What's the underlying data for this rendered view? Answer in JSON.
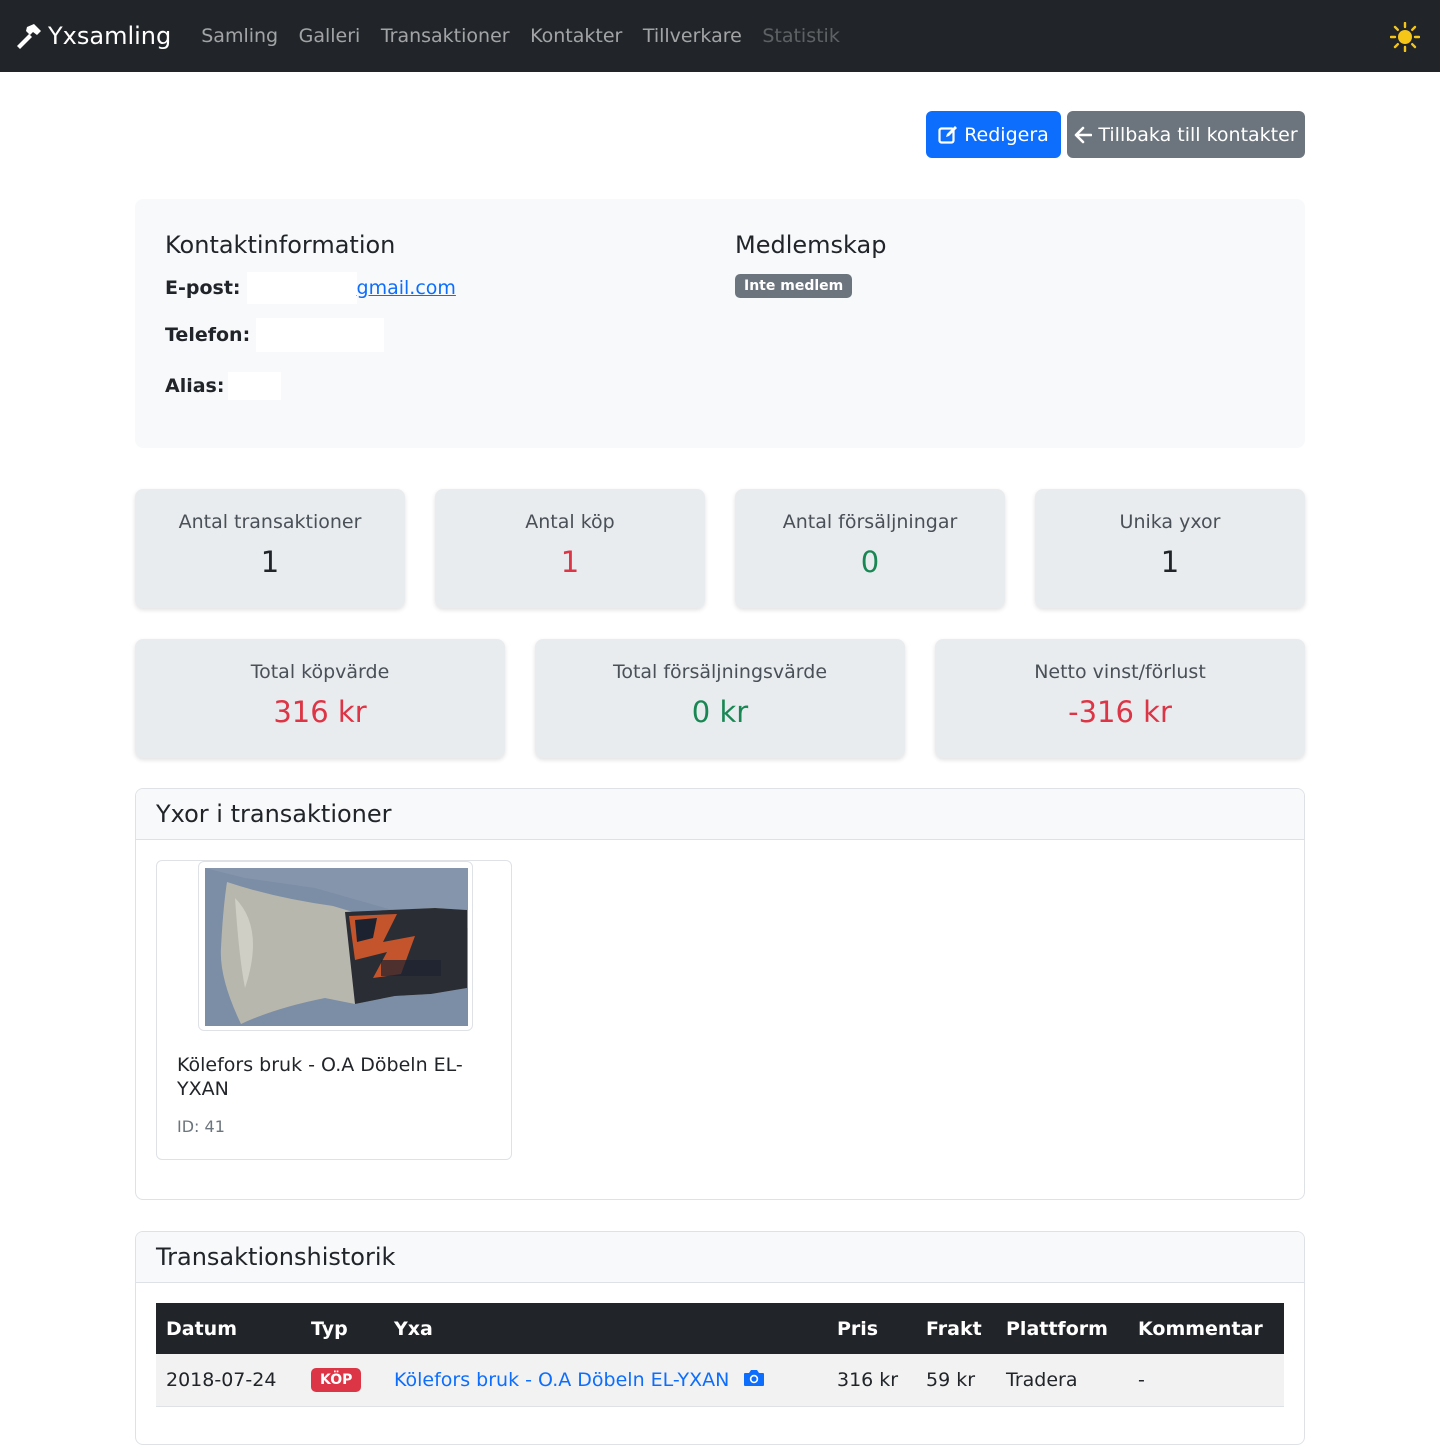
{
  "nav": {
    "brand": "Yxsamling",
    "links": [
      "Samling",
      "Galleri",
      "Transaktioner",
      "Kontakter",
      "Tillverkare",
      "Statistik"
    ]
  },
  "actions": {
    "edit": "Redigera",
    "back": "Tillbaka till kontakter"
  },
  "contact": {
    "title": "Kontaktinformation",
    "email_label": "E-post:",
    "email_value": "gmail.com",
    "phone_label": "Telefon:",
    "alias_label": "Alias:"
  },
  "membership": {
    "title": "Medlemskap",
    "badge": "Inte medlem"
  },
  "stats": {
    "transactions": {
      "label": "Antal transaktioner",
      "value": "1"
    },
    "purchases": {
      "label": "Antal köp",
      "value": "1"
    },
    "sales": {
      "label": "Antal försäljningar",
      "value": "0"
    },
    "unique_axes": {
      "label": "Unika yxor",
      "value": "1"
    },
    "total_purchase": {
      "label": "Total köpvärde",
      "value": "316 kr"
    },
    "total_sales": {
      "label": "Total försäljningsvärde",
      "value": "0 kr"
    },
    "net": {
      "label": "Netto vinst/förlust",
      "value": "-316 kr"
    }
  },
  "axes_section": {
    "title": "Yxor i transaktioner",
    "items": [
      {
        "name": "Kölefors bruk - O.A Döbeln EL-YXAN",
        "id": "ID: 41"
      }
    ]
  },
  "history": {
    "title": "Transaktionshistorik",
    "columns": [
      "Datum",
      "Typ",
      "Yxa",
      "Pris",
      "Frakt",
      "Plattform",
      "Kommentar"
    ],
    "rows": [
      {
        "date": "2018-07-24",
        "type": "KÖP",
        "axe": "Kölefors bruk - O.A Döbeln EL-YXAN",
        "price": "316 kr",
        "shipping": "59 kr",
        "platform": "Tradera",
        "comment": "-"
      }
    ]
  },
  "colors": {
    "primary": "#0d6efd",
    "secondary": "#6c757d",
    "danger": "#dc3545",
    "success": "#198754",
    "navbar": "#212529"
  }
}
